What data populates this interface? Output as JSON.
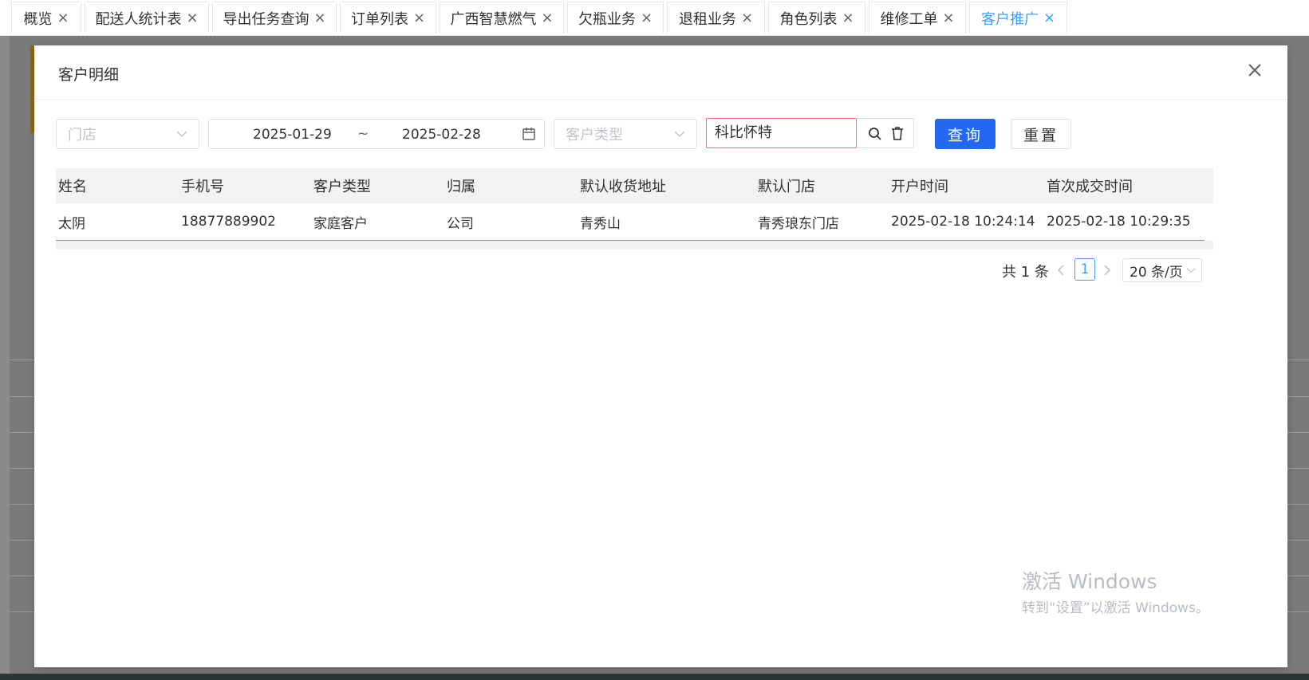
{
  "tabs": [
    {
      "label": "概览"
    },
    {
      "label": "配送人统计表"
    },
    {
      "label": "导出任务查询"
    },
    {
      "label": "订单列表"
    },
    {
      "label": "广西智慧燃气"
    },
    {
      "label": "欠瓶业务"
    },
    {
      "label": "退租业务"
    },
    {
      "label": "角色列表"
    },
    {
      "label": "维修工单"
    },
    {
      "label": "客户推广",
      "active": true
    }
  ],
  "tab_close_glyph": "×",
  "modal": {
    "title": "客户明细",
    "filters": {
      "store_placeholder": "门店",
      "date_start": "2025-01-29",
      "date_separator": "~",
      "date_end": "2025-02-28",
      "customer_type_placeholder": "客户类型",
      "keyword_value": "科比怀特",
      "query_label": "查询",
      "reset_label": "重置"
    },
    "table": {
      "columns": [
        "姓名",
        "手机号",
        "客户类型",
        "归属",
        "默认收货地址",
        "默认门店",
        "开户时间",
        "首次成交时间"
      ],
      "rows": [
        [
          "太阴",
          "18877889902",
          "家庭客户",
          "公司",
          "青秀山",
          "青秀琅东门店",
          "2025-02-18 10:24:14",
          "2025-02-18 10:29:35"
        ]
      ]
    },
    "pagination": {
      "total_text": "共 1 条",
      "current_page": "1",
      "page_size": "20 条/页"
    }
  },
  "watermark": {
    "line1": "激活 Windows",
    "line2": "转到“设置”以激活 Windows。"
  },
  "icons": [
    "close-icon",
    "chevron-down-icon",
    "calendar-icon",
    "search-icon",
    "trash-icon",
    "chevron-left-icon",
    "chevron-right-icon"
  ],
  "colors": {
    "primary": "#2468f2",
    "active_tab": "#409eff",
    "error_border": "#f56c6c"
  }
}
